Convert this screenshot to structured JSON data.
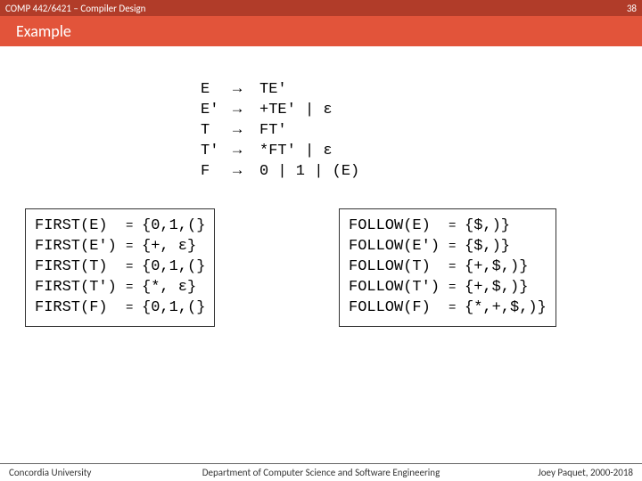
{
  "header": {
    "course": "COMP 442/6421 – Compiler Design",
    "page_num": "38"
  },
  "title": "Example",
  "grammar": {
    "lhs": "E\nE'\nT\nT'\nF",
    "arrows": "→\n→\n→\n→\n→",
    "rhs": "TE'\n+TE' | ε\nFT'\n*FT' | ε\n0 | 1 | (E)"
  },
  "first": {
    "names": "FIRST(E)\nFIRST(E')\nFIRST(T)\nFIRST(T')\nFIRST(F)",
    "eq": "=\n=\n=\n=\n=",
    "sets": "{0,1,(}\n{+, ε}\n{0,1,(}\n{*, ε}\n{0,1,(}"
  },
  "follow": {
    "names": "FOLLOW(E)\nFOLLOW(E')\nFOLLOW(T)\nFOLLOW(T')\nFOLLOW(F)",
    "eq": "=\n=\n=\n=\n=",
    "sets": "{$,)}\n{$,)}\n{+,$,)}\n{+,$,)}\n{*,+,$,)}"
  },
  "footer": {
    "left": "Concordia University",
    "center": "Department of Computer Science and Software Engineering",
    "right": "Joey Paquet, 2000-2018"
  },
  "chart_data": {
    "type": "table",
    "title": "FIRST and FOLLOW sets for expression grammar",
    "grammar_rules": [
      {
        "lhs": "E",
        "rhs": "TE'"
      },
      {
        "lhs": "E'",
        "rhs": "+TE' | ε"
      },
      {
        "lhs": "T",
        "rhs": "FT'"
      },
      {
        "lhs": "T'",
        "rhs": "*FT' | ε"
      },
      {
        "lhs": "F",
        "rhs": "0 | 1 | (E)"
      }
    ],
    "first_sets": {
      "E": [
        "0",
        "1",
        "("
      ],
      "E'": [
        "+",
        "ε"
      ],
      "T": [
        "0",
        "1",
        "("
      ],
      "T'": [
        "*",
        "ε"
      ],
      "F": [
        "0",
        "1",
        "("
      ]
    },
    "follow_sets": {
      "E": [
        "$",
        ")"
      ],
      "E'": [
        "$",
        ")"
      ],
      "T": [
        "+",
        "$",
        ")"
      ],
      "T'": [
        "+",
        "$",
        ")"
      ],
      "F": [
        "*",
        "+",
        "$",
        ")"
      ]
    }
  }
}
